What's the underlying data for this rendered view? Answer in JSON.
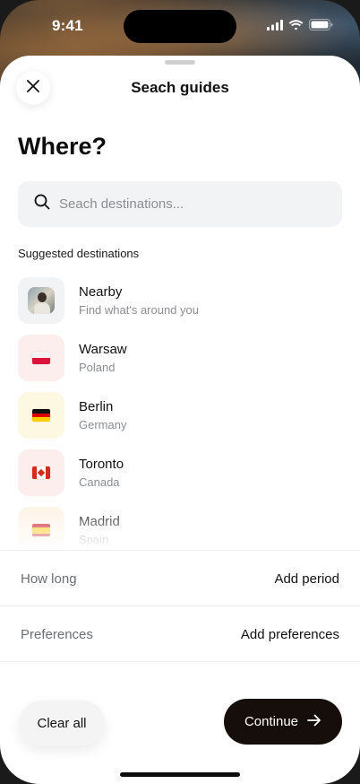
{
  "status_bar": {
    "time": "9:41",
    "icons": [
      "cellular-signal-icon",
      "wifi-icon",
      "battery-icon"
    ]
  },
  "sheet": {
    "title": "Seach guides",
    "close_icon": "close-icon"
  },
  "heading": "Where?",
  "search": {
    "placeholder": "Seach destinations...",
    "value": "",
    "icon": "search-icon"
  },
  "suggested": {
    "label": "Suggested destinations",
    "items": [
      {
        "name": "Nearby",
        "subtitle": "Find what's around you",
        "thumb": "avatar-photo",
        "bg": "#f1f3f5"
      },
      {
        "name": "Warsaw",
        "subtitle": "Poland",
        "thumb": "poland-flag-icon",
        "bg": "#fdeeee"
      },
      {
        "name": "Berlin",
        "subtitle": "Germany",
        "thumb": "germany-flag-icon",
        "bg": "#fdf8e1"
      },
      {
        "name": "Toronto",
        "subtitle": "Canada",
        "thumb": "canada-flag-icon",
        "bg": "#fdeeee"
      },
      {
        "name": "Madrid",
        "subtitle": "Spain",
        "thumb": "spain-flag-icon",
        "bg": "#fdf3e6"
      }
    ]
  },
  "options": {
    "how_long": {
      "label": "How long",
      "action": "Add period"
    },
    "preferences": {
      "label": "Preferences",
      "action": "Add preferences"
    }
  },
  "footer": {
    "clear_label": "Clear all",
    "continue_label": "Continue",
    "continue_icon": "arrow-right-icon"
  },
  "colors": {
    "accent_dark": "#150e0b",
    "search_bg": "#f2f3f4",
    "muted_text": "#8a8d91"
  }
}
